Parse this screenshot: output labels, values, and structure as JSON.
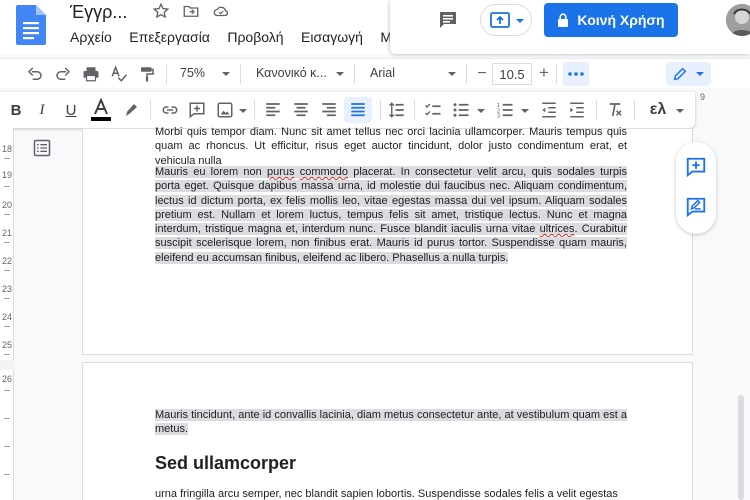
{
  "app": {
    "title": "Έγγρ...",
    "menu": [
      "Αρχείο",
      "Επεξεργασία",
      "Προβολή",
      "Εισαγωγή",
      "Μο"
    ],
    "share_label": "Κοινή Χρήση"
  },
  "toolbar": {
    "zoom": "75%",
    "style": "Κανονικό κ...",
    "font": "Arial",
    "font_size": "10.5",
    "minus": "−",
    "plus": "+",
    "input_tool": "ελ",
    "ruler_corner": "9"
  },
  "ruler": {
    "labels": [
      "18",
      "19",
      "20",
      "21",
      "22",
      "23",
      "24",
      "25",
      "26"
    ]
  },
  "document": {
    "page1": {
      "para1": "Morbi quis tempor diam. Nunc sit amet tellus nec orci lacinia ullamcorper. Mauris tempus quis quam ac rhoncus. Ut efficitur, risus eget auctor tincidunt, dolor justo condimentum erat, et vehicula nulla",
      "para2": {
        "part1": "Mauris eu lorem non ",
        "sq1": "purus",
        "part2": " ",
        "sq2": "commodo",
        "part3": " placerat. In consectetur velit arcu, quis sodales turpis porta eget. Quisque dapibus massa urna, id molestie dui faucibus nec. Aliquam condimentum, lectus id dictum porta, ex felis mollis leo, vitae egestas massa dui vel ipsum. Aliquam sodales pretium est. Nullam et lorem luctus, tempus felis sit amet, tristique lectus. Nunc et magna interdum, tristique magna et, interdum nunc. Fusce blandit iaculis urna vitae ",
        "sq3": "ultrices",
        "part4": ". Curabitur suscipit scelerisque lorem, non finibus erat. Mauris id purus tortor. Suspendisse quam mauris, eleifend eu accumsan finibus, eleifend ac libero. Phasellus a nulla turpis."
      }
    },
    "page2": {
      "para1": "Mauris tincidunt, ante id convallis lacinia, diam metus consectetur ante, at vestibulum quam est a metus.",
      "heading": "Sed ullamcorper",
      "para2": "urna fringilla arcu semper, nec blandit sapien lobortis. Suspendisse sodales felis a velit egestas"
    }
  },
  "colors": {
    "accent": "#1a73e8",
    "selection": "#dadce0",
    "spelling": "#d93025",
    "docs_blue": "#4285f4"
  }
}
